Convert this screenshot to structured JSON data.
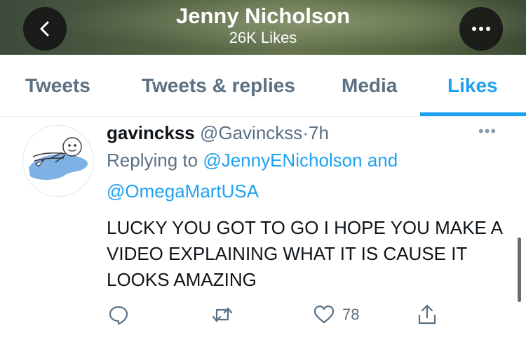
{
  "header": {
    "title": "Jenny Nicholson",
    "subtitle": "26K Likes",
    "back_icon": "chevron-left-icon",
    "more_icon": "more-dots-icon"
  },
  "tabs": [
    {
      "label": "Tweets",
      "active": false
    },
    {
      "label": "Tweets & replies",
      "active": false
    },
    {
      "label": "Media",
      "active": false
    },
    {
      "label": "Likes",
      "active": true
    }
  ],
  "tweet": {
    "display_name": "gavinckss",
    "handle": "@Gavinckss",
    "separator": "·",
    "time": "7h",
    "reply_prefix": "Replying to",
    "reply_to_1": "@JennyENicholson",
    "reply_and": "and",
    "reply_to_2": "@OmegaMartUSA",
    "text": "LUCKY YOU GOT TO GO I HOPE YOU MAKE A VIDEO EXPLAINING WHAT IT IS CAUSE IT LOOKS AMAZING",
    "likes": "78"
  },
  "colors": {
    "accent": "#1da1f2",
    "muted": "#5b7083",
    "text": "#0f1419"
  }
}
